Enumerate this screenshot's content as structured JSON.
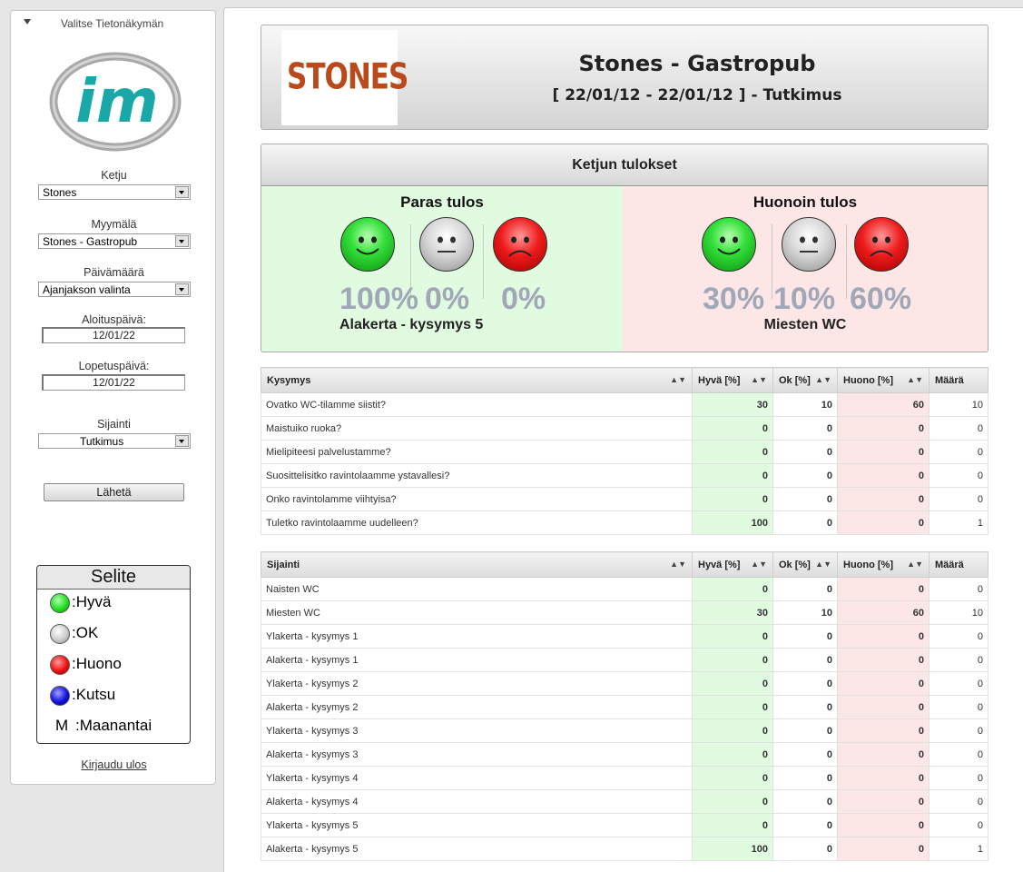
{
  "sidebar": {
    "header": "Valitse Tietonäkymän",
    "logo_text": "im",
    "chain_label": "Ketju",
    "chain_value": "Stones",
    "store_label": "Myymälä",
    "store_value": "Stones - Gastropub",
    "date_label": "Päivämäärä",
    "date_value": "Ajanjakson valinta",
    "start_label": "Aloituspäivä:",
    "start_value": "12/01/22",
    "end_label": "Lopetuspäivä:",
    "end_value": "12/01/22",
    "location_label": "Sijainti",
    "location_value": "Tutkimus",
    "submit_label": "Lähetä",
    "legend": {
      "title": "Selite",
      "items": [
        {
          "label": ":Hyvä",
          "color": "#22dd22"
        },
        {
          "label": ":OK",
          "color": "#cccccc"
        },
        {
          "label": ":Huono",
          "color": "#ee1111"
        },
        {
          "label": ":Kutsu",
          "color": "#1111dd"
        },
        {
          "symbol": "M",
          "label": ":Maanantai"
        }
      ]
    },
    "logout": "Kirjaudu ulos"
  },
  "header": {
    "logo_text": "STONES",
    "title": "Stones - Gastropub",
    "subtitle": "[ 22/01/12 - 22/01/12 ] - Tutkimus"
  },
  "results": {
    "title": "Ketjun tulokset",
    "best": {
      "title": "Paras tulos",
      "good": "100%",
      "ok": "0%",
      "bad": "0%",
      "name": "Alakerta - kysymys 5"
    },
    "worst": {
      "title": "Huonoin tulos",
      "good": "30%",
      "ok": "10%",
      "bad": "60%",
      "name": "Miesten WC"
    }
  },
  "questions_table": {
    "headers": [
      "Kysymys",
      "Hyvä [%]",
      "Ok [%]",
      "Huono [%]",
      "Määrä"
    ],
    "rows": [
      [
        "Ovatko WC-tilamme siistit?",
        "30",
        "10",
        "60",
        "10"
      ],
      [
        "Maistuiko ruoka?",
        "0",
        "0",
        "0",
        "0"
      ],
      [
        "Mielipiteesi palvelustamme?",
        "0",
        "0",
        "0",
        "0"
      ],
      [
        "Suosittelisitko ravintolaamme ystavallesi?",
        "0",
        "0",
        "0",
        "0"
      ],
      [
        "Onko ravintolamme viihtyisa?",
        "0",
        "0",
        "0",
        "0"
      ],
      [
        "Tuletko ravintolaamme uudelleen?",
        "100",
        "0",
        "0",
        "1"
      ]
    ]
  },
  "location_table": {
    "headers": [
      "Sijainti",
      "Hyvä [%]",
      "Ok [%]",
      "Huono [%]",
      "Määrä"
    ],
    "rows": [
      [
        "Naisten WC",
        "0",
        "0",
        "0",
        "0"
      ],
      [
        "Miesten WC",
        "30",
        "10",
        "60",
        "10"
      ],
      [
        "Ylakerta - kysymys 1",
        "0",
        "0",
        "0",
        "0"
      ],
      [
        "Alakerta - kysymys 1",
        "0",
        "0",
        "0",
        "0"
      ],
      [
        "Ylakerta - kysymys 2",
        "0",
        "0",
        "0",
        "0"
      ],
      [
        "Alakerta - kysymys 2",
        "0",
        "0",
        "0",
        "0"
      ],
      [
        "Ylakerta - kysymys 3",
        "0",
        "0",
        "0",
        "0"
      ],
      [
        "Alakerta - kysymys 3",
        "0",
        "0",
        "0",
        "0"
      ],
      [
        "Ylakerta - kysymys 4",
        "0",
        "0",
        "0",
        "0"
      ],
      [
        "Alakerta - kysymys 4",
        "0",
        "0",
        "0",
        "0"
      ],
      [
        "Ylakerta - kysymys 5",
        "0",
        "0",
        "0",
        "0"
      ],
      [
        "Alakerta - kysymys 5",
        "100",
        "0",
        "0",
        "1"
      ]
    ]
  }
}
